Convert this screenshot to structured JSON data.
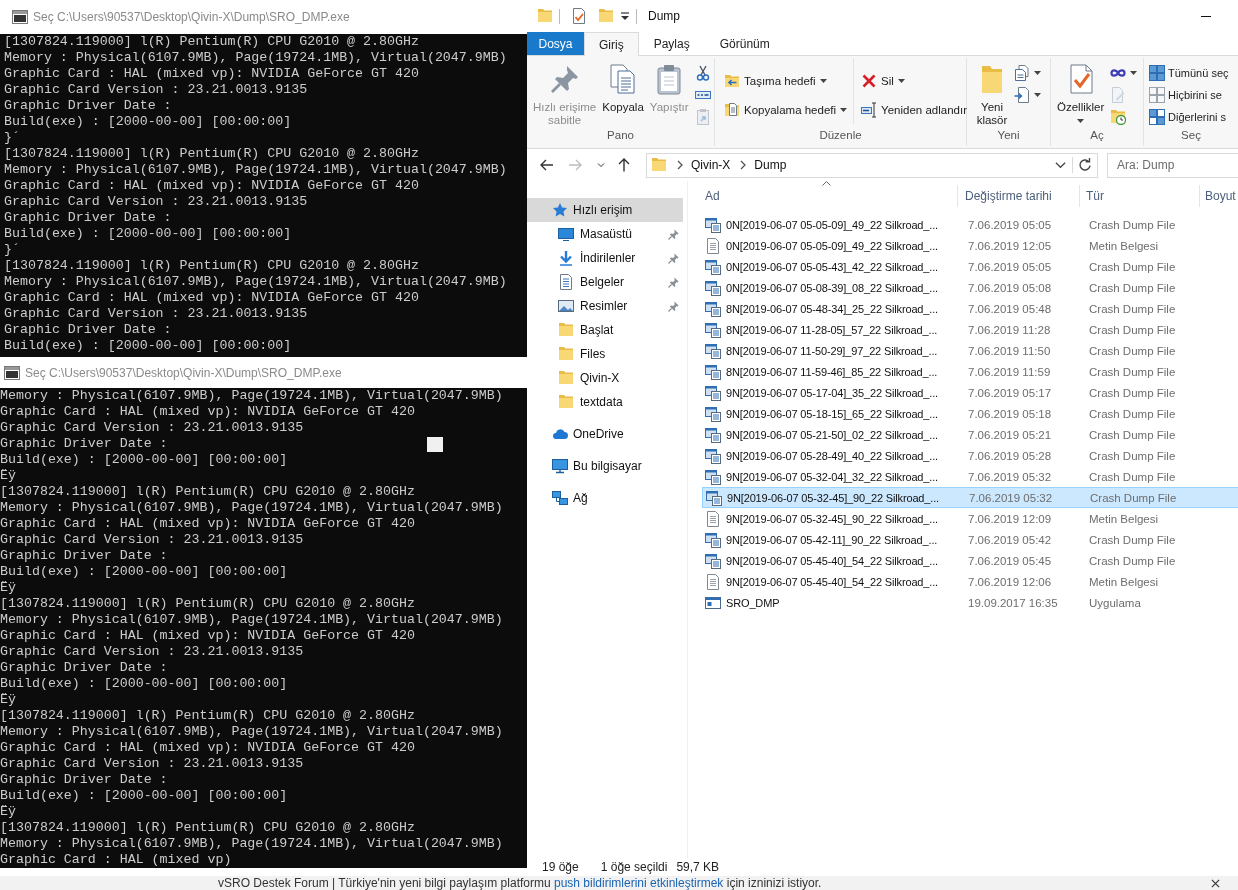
{
  "consoles": [
    {
      "title": "Seç C:\\Users\\90537\\Desktop\\Qivin-X\\Dump\\SRO_DMP.exe",
      "show_cursor": false,
      "lines": [
        "[1307824.119000] l(R) Pentium(R) CPU G2010 @ 2.80GHz",
        "Memory : Physical(6107.9MB), Page(19724.1MB), Virtual(2047.9MB)",
        "Graphic Card : HAL (mixed vp): NVIDIA GeForce GT 420",
        "Graphic Card Version : 23.21.0013.9135",
        "Graphic Driver Date :",
        "Build(exe) : [2000-00-00] [00:00:00]",
        "}´",
        "[1307824.119000] l(R) Pentium(R) CPU G2010 @ 2.80GHz",
        "Memory : Physical(6107.9MB), Page(19724.1MB), Virtual(2047.9MB)",
        "Graphic Card : HAL (mixed vp): NVIDIA GeForce GT 420",
        "Graphic Card Version : 23.21.0013.9135",
        "Graphic Driver Date :",
        "Build(exe) : [2000-00-00] [00:00:00]",
        "}´",
        "[1307824.119000] l(R) Pentium(R) CPU G2010 @ 2.80GHz",
        "Memory : Physical(6107.9MB), Page(19724.1MB), Virtual(2047.9MB)",
        "Graphic Card : HAL (mixed vp): NVIDIA GeForce GT 420",
        "Graphic Card Version : 23.21.0013.9135",
        "Graphic Driver Date :",
        "Build(exe) : [2000-00-00] [00:00:00]"
      ]
    },
    {
      "title": "Seç C:\\Users\\90537\\Desktop\\Qivin-X\\Dump\\SRO_DMP.exe",
      "show_cursor": true,
      "lines": [
        "Memory : Physical(6107.9MB), Page(19724.1MB), Virtual(2047.9MB)",
        "Graphic Card : HAL (mixed vp): NVIDIA GeForce GT 420",
        "Graphic Card Version : 23.21.0013.9135",
        "Graphic Driver Date :",
        "Build(exe) : [2000-00-00] [00:00:00]",
        "Ëÿ",
        "[1307824.119000] l(R) Pentium(R) CPU G2010 @ 2.80GHz",
        "Memory : Physical(6107.9MB), Page(19724.1MB), Virtual(2047.9MB)",
        "Graphic Card : HAL (mixed vp): NVIDIA GeForce GT 420",
        "Graphic Card Version : 23.21.0013.9135",
        "Graphic Driver Date :",
        "Build(exe) : [2000-00-00] [00:00:00]",
        "Ëÿ",
        "[1307824.119000] l(R) Pentium(R) CPU G2010 @ 2.80GHz",
        "Memory : Physical(6107.9MB), Page(19724.1MB), Virtual(2047.9MB)",
        "Graphic Card : HAL (mixed vp): NVIDIA GeForce GT 420",
        "Graphic Card Version : 23.21.0013.9135",
        "Graphic Driver Date :",
        "Build(exe) : [2000-00-00] [00:00:00]",
        "Ëÿ",
        "[1307824.119000] l(R) Pentium(R) CPU G2010 @ 2.80GHz",
        "Memory : Physical(6107.9MB), Page(19724.1MB), Virtual(2047.9MB)",
        "Graphic Card : HAL (mixed vp): NVIDIA GeForce GT 420",
        "Graphic Card Version : 23.21.0013.9135",
        "Graphic Driver Date :",
        "Build(exe) : [2000-00-00] [00:00:00]",
        "Ëÿ",
        "[1307824.119000] l(R) Pentium(R) CPU G2010 @ 2.80GHz",
        "Memory : Physical(6107.9MB), Page(19724.1MB), Virtual(2047.9MB)",
        "Graphic Card : HAL (mixed vp)"
      ]
    }
  ],
  "explorer": {
    "title": "Dump",
    "tabs": [
      {
        "label": "Dosya",
        "kind": "file",
        "selected": false
      },
      {
        "label": "Giriş",
        "kind": "tab",
        "selected": true
      },
      {
        "label": "Paylaş",
        "kind": "tab",
        "selected": false
      },
      {
        "label": "Görünüm",
        "kind": "tab",
        "selected": false
      }
    ],
    "ribbon": {
      "groups": [
        {
          "label": "Pano",
          "columns": [
            {
              "kind": "large",
              "label": "Hızlı erişime\nsabitle",
              "disabled": true,
              "dropdown": false
            },
            {
              "kind": "large",
              "label": "Kopyala",
              "disabled": false,
              "dropdown": false
            },
            {
              "kind": "large",
              "label": "Yapıştır",
              "disabled": true,
              "dropdown": false
            },
            {
              "kind": "stack",
              "buttons": [
                {
                  "kind": "icon",
                  "disabled": false,
                  "dropdown": false
                },
                {
                  "kind": "icon",
                  "disabled": false,
                  "dropdown": false
                },
                {
                  "kind": "icon",
                  "disabled": true,
                  "dropdown": false
                }
              ]
            }
          ]
        },
        {
          "label": "Düzenle",
          "columns": [
            {
              "kind": "stack",
              "buttons": [
                {
                  "kind": "small",
                  "label": "Taşıma hedefi",
                  "disabled": false,
                  "dropdown": true
                },
                {
                  "kind": "small",
                  "label": "Kopyalama hedefi",
                  "disabled": false,
                  "dropdown": true
                }
              ]
            },
            {
              "kind": "stack",
              "buttons": [
                {
                  "kind": "small",
                  "label": "Sil",
                  "disabled": false,
                  "dropdown": true
                },
                {
                  "kind": "small",
                  "label": "Yeniden adlandır",
                  "disabled": false,
                  "dropdown": false
                }
              ]
            }
          ]
        },
        {
          "label": "Yeni",
          "columns": [
            {
              "kind": "large",
              "label": "Yeni\nklasör",
              "disabled": false,
              "dropdown": false
            },
            {
              "kind": "stack",
              "buttons": [
                {
                  "kind": "icon",
                  "disabled": false,
                  "dropdown": true
                },
                {
                  "kind": "icon",
                  "disabled": false,
                  "dropdown": true
                }
              ]
            }
          ]
        },
        {
          "label": "Aç",
          "columns": [
            {
              "kind": "large",
              "label": "Özellikler",
              "disabled": false,
              "dropdown": true
            },
            {
              "kind": "stack",
              "buttons": [
                {
                  "kind": "icon",
                  "disabled": false,
                  "dropdown": true
                },
                {
                  "kind": "icon",
                  "disabled": true,
                  "dropdown": false
                },
                {
                  "kind": "icon",
                  "disabled": false,
                  "dropdown": false
                }
              ]
            }
          ]
        },
        {
          "label": "Seç",
          "columns": [
            {
              "kind": "stack",
              "buttons": [
                {
                  "kind": "small",
                  "label": "Tümünü seç",
                  "disabled": false,
                  "dropdown": false
                },
                {
                  "kind": "small",
                  "label": "Hiçbirini se",
                  "disabled": false,
                  "dropdown": false
                },
                {
                  "kind": "small",
                  "label": "Diğerlerini s",
                  "disabled": false,
                  "dropdown": false
                }
              ]
            }
          ]
        }
      ]
    },
    "nav_buttons": [
      {
        "kind": "back",
        "disabled": false
      },
      {
        "kind": "forward",
        "disabled": true
      },
      {
        "kind": "recent",
        "disabled": false
      },
      {
        "kind": "up",
        "disabled": false
      }
    ],
    "address_bar": {
      "path": [
        "Qivin-X",
        "Dump"
      ]
    },
    "search": {
      "placeholder": "Ara: Dump"
    },
    "nav_pane": {
      "items": [
        {
          "label": "Hızlı erişim",
          "kind": "quick-access",
          "selected": true,
          "children": [
            {
              "label": "Masaüstü",
              "kind": "desktop",
              "selected": false,
              "pinned": true
            },
            {
              "label": "İndirilenler",
              "kind": "downloads",
              "selected": false,
              "pinned": true
            },
            {
              "label": "Belgeler",
              "kind": "documents",
              "selected": false,
              "pinned": true
            },
            {
              "label": "Resimler",
              "kind": "pictures",
              "selected": false,
              "pinned": true
            },
            {
              "label": "Başlat",
              "kind": "folder",
              "selected": false,
              "pinned": false
            },
            {
              "label": "Files",
              "kind": "folder",
              "selected": false,
              "pinned": false
            },
            {
              "label": "Qivin-X",
              "kind": "folder",
              "selected": false,
              "pinned": false
            },
            {
              "label": "textdata",
              "kind": "folder",
              "selected": false,
              "pinned": false
            }
          ]
        },
        {
          "label": "OneDrive",
          "kind": "onedrive",
          "selected": false
        },
        {
          "label": "Bu bilgisayar",
          "kind": "this-pc",
          "selected": false
        },
        {
          "label": "Ağ",
          "kind": "network",
          "selected": false
        }
      ]
    },
    "file_list": {
      "columns": [
        {
          "label": "Ad",
          "sorted": true
        },
        {
          "label": "Değiştirme tarihi",
          "sorted": false
        },
        {
          "label": "Tür",
          "sorted": false
        },
        {
          "label": "Boyut",
          "sorted": false
        }
      ],
      "rows": [
        {
          "name": "0N[2019-06-07 05-05-09]_49_22 Silkroad_...",
          "date": "7.06.2019 05:05",
          "type": "Crash Dump File",
          "kind": "dump",
          "selected": false
        },
        {
          "name": "0N[2019-06-07 05-05-09]_49_22 Silkroad_...",
          "date": "7.06.2019 12:05",
          "type": "Metin Belgesi",
          "kind": "text",
          "selected": false
        },
        {
          "name": "0N[2019-06-07 05-05-43]_42_22 Silkroad_...",
          "date": "7.06.2019 05:05",
          "type": "Crash Dump File",
          "kind": "dump",
          "selected": false
        },
        {
          "name": "0N[2019-06-07 05-08-39]_08_22 Silkroad_...",
          "date": "7.06.2019 05:08",
          "type": "Crash Dump File",
          "kind": "dump",
          "selected": false
        },
        {
          "name": "8N[2019-06-07 05-48-34]_25_22 Silkroad_...",
          "date": "7.06.2019 05:48",
          "type": "Crash Dump File",
          "kind": "dump",
          "selected": false
        },
        {
          "name": "8N[2019-06-07 11-28-05]_57_22 Silkroad_...",
          "date": "7.06.2019 11:28",
          "type": "Crash Dump File",
          "kind": "dump",
          "selected": false
        },
        {
          "name": "8N[2019-06-07 11-50-29]_97_22 Silkroad_...",
          "date": "7.06.2019 11:50",
          "type": "Crash Dump File",
          "kind": "dump",
          "selected": false
        },
        {
          "name": "8N[2019-06-07 11-59-46]_85_22 Silkroad_...",
          "date": "7.06.2019 11:59",
          "type": "Crash Dump File",
          "kind": "dump",
          "selected": false
        },
        {
          "name": "9N[2019-06-07 05-17-04]_35_22 Silkroad_...",
          "date": "7.06.2019 05:17",
          "type": "Crash Dump File",
          "kind": "dump",
          "selected": false
        },
        {
          "name": "9N[2019-06-07 05-18-15]_65_22 Silkroad_...",
          "date": "7.06.2019 05:18",
          "type": "Crash Dump File",
          "kind": "dump",
          "selected": false
        },
        {
          "name": "9N[2019-06-07 05-21-50]_02_22 Silkroad_...",
          "date": "7.06.2019 05:21",
          "type": "Crash Dump File",
          "kind": "dump",
          "selected": false
        },
        {
          "name": "9N[2019-06-07 05-28-49]_40_22 Silkroad_...",
          "date": "7.06.2019 05:28",
          "type": "Crash Dump File",
          "kind": "dump",
          "selected": false
        },
        {
          "name": "9N[2019-06-07 05-32-04]_32_22 Silkroad_...",
          "date": "7.06.2019 05:32",
          "type": "Crash Dump File",
          "kind": "dump",
          "selected": false
        },
        {
          "name": "9N[2019-06-07 05-32-45]_90_22 Silkroad_...",
          "date": "7.06.2019 05:32",
          "type": "Crash Dump File",
          "kind": "dump",
          "selected": true
        },
        {
          "name": "9N[2019-06-07 05-32-45]_90_22 Silkroad_...",
          "date": "7.06.2019 12:09",
          "type": "Metin Belgesi",
          "kind": "text",
          "selected": false
        },
        {
          "name": "9N[2019-06-07 05-42-11]_90_22 Silkroad_...",
          "date": "7.06.2019 05:42",
          "type": "Crash Dump File",
          "kind": "dump",
          "selected": false
        },
        {
          "name": "9N[2019-06-07 05-45-40]_54_22 Silkroad_...",
          "date": "7.06.2019 05:45",
          "type": "Crash Dump File",
          "kind": "dump",
          "selected": false
        },
        {
          "name": "9N[2019-06-07 05-45-40]_54_22 Silkroad_...",
          "date": "7.06.2019 12:06",
          "type": "Metin Belgesi",
          "kind": "text",
          "selected": false
        },
        {
          "name": "SRO_DMP",
          "date": "19.09.2017 16:35",
          "type": "Uygulama",
          "kind": "app",
          "selected": false
        }
      ]
    },
    "status_bar": {
      "items": [
        "19 öğe",
        "1 öğe seçildi",
        "59,7 KB"
      ]
    }
  },
  "notification": {
    "text": "vSRO Destek Forum | Türkiye'nin yeni bilgi paylaşım platformu ",
    "link": "push bildirimlerini etkinleştirmek",
    "text_end": " için izninizi istiyor."
  }
}
